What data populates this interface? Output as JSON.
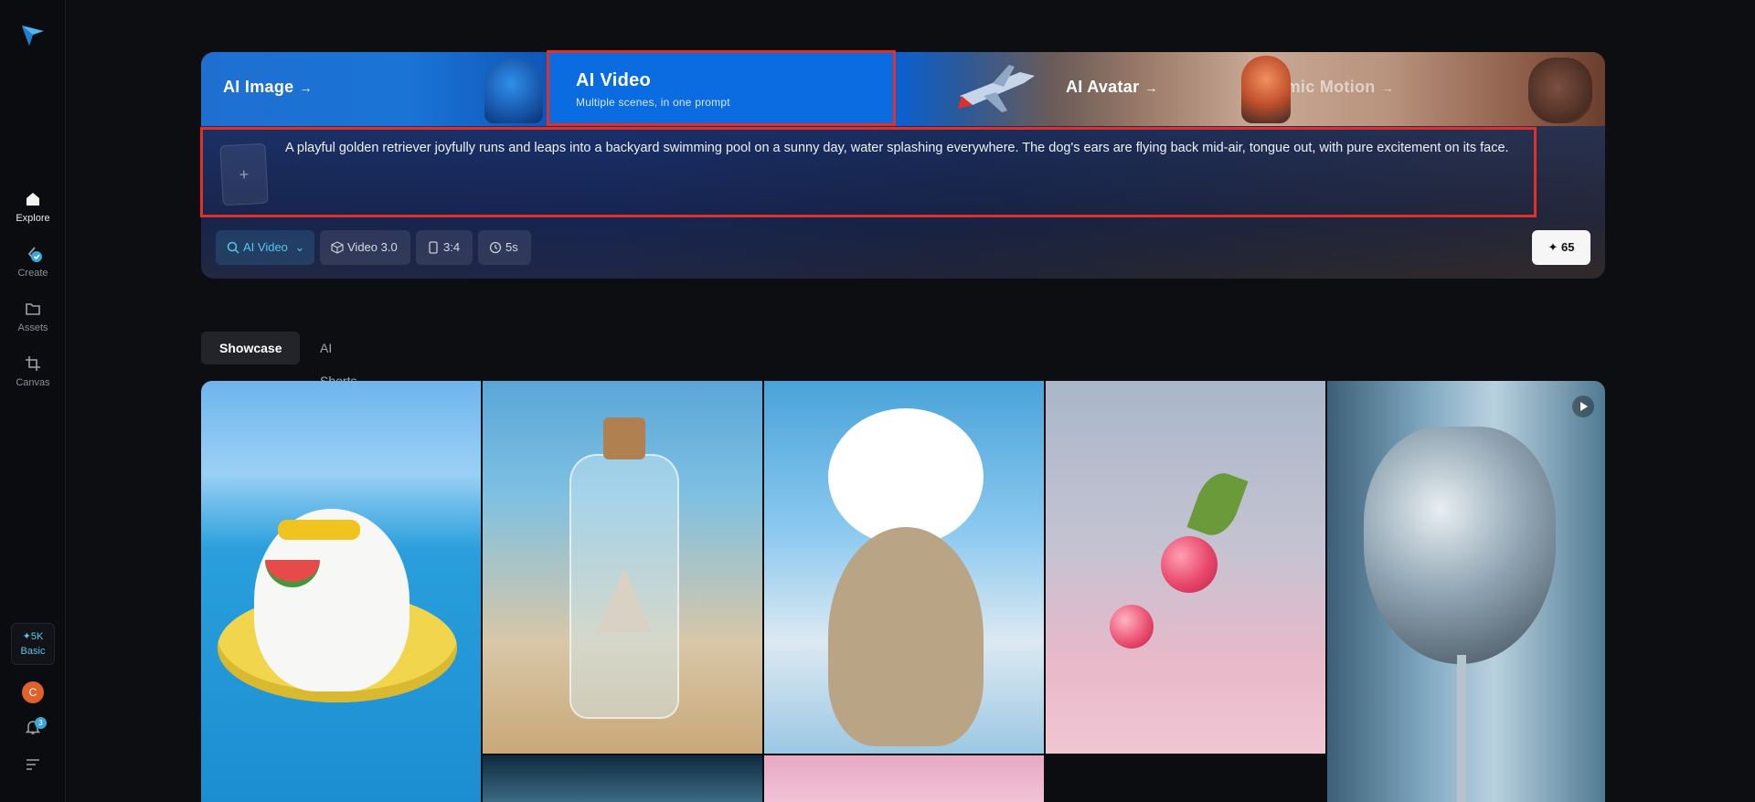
{
  "sidebar": {
    "items": [
      {
        "label": "Explore"
      },
      {
        "label": "Create"
      },
      {
        "label": "Assets"
      },
      {
        "label": "Canvas"
      }
    ],
    "credits": {
      "amount": "✦5K",
      "plan": "Basic"
    },
    "avatar_initial": "C",
    "notifications_count": "3"
  },
  "hero": {
    "tabs": [
      {
        "label": "AI Image",
        "arrow": "→"
      },
      {
        "label": "AI Video",
        "subtitle": "Multiple scenes, in one prompt"
      },
      {
        "label": "AI Avatar",
        "arrow": "→"
      },
      {
        "label": "Mimic Motion",
        "arrow": "→"
      }
    ],
    "prompt": {
      "upload_icon": "+",
      "text": "A playful golden retriever joyfully runs and leaps into a backyard swimming pool on a sunny day, water splashing everywhere. The dog's ears are flying back mid-air, tongue out, with pure excitement on its face."
    },
    "toolbar": {
      "mode": "AI Video",
      "model": "Video 3.0",
      "ratio": "3:4",
      "duration": "5s"
    },
    "generate": {
      "icon": "✦",
      "cost": "65"
    }
  },
  "sections": {
    "tabs": [
      {
        "label": "Showcase"
      },
      {
        "label": "AI Shorts"
      }
    ]
  },
  "colors": {
    "accent": "#0a6ce0",
    "highlight_outline": "#e0302a",
    "cyan": "#56c5ea"
  }
}
